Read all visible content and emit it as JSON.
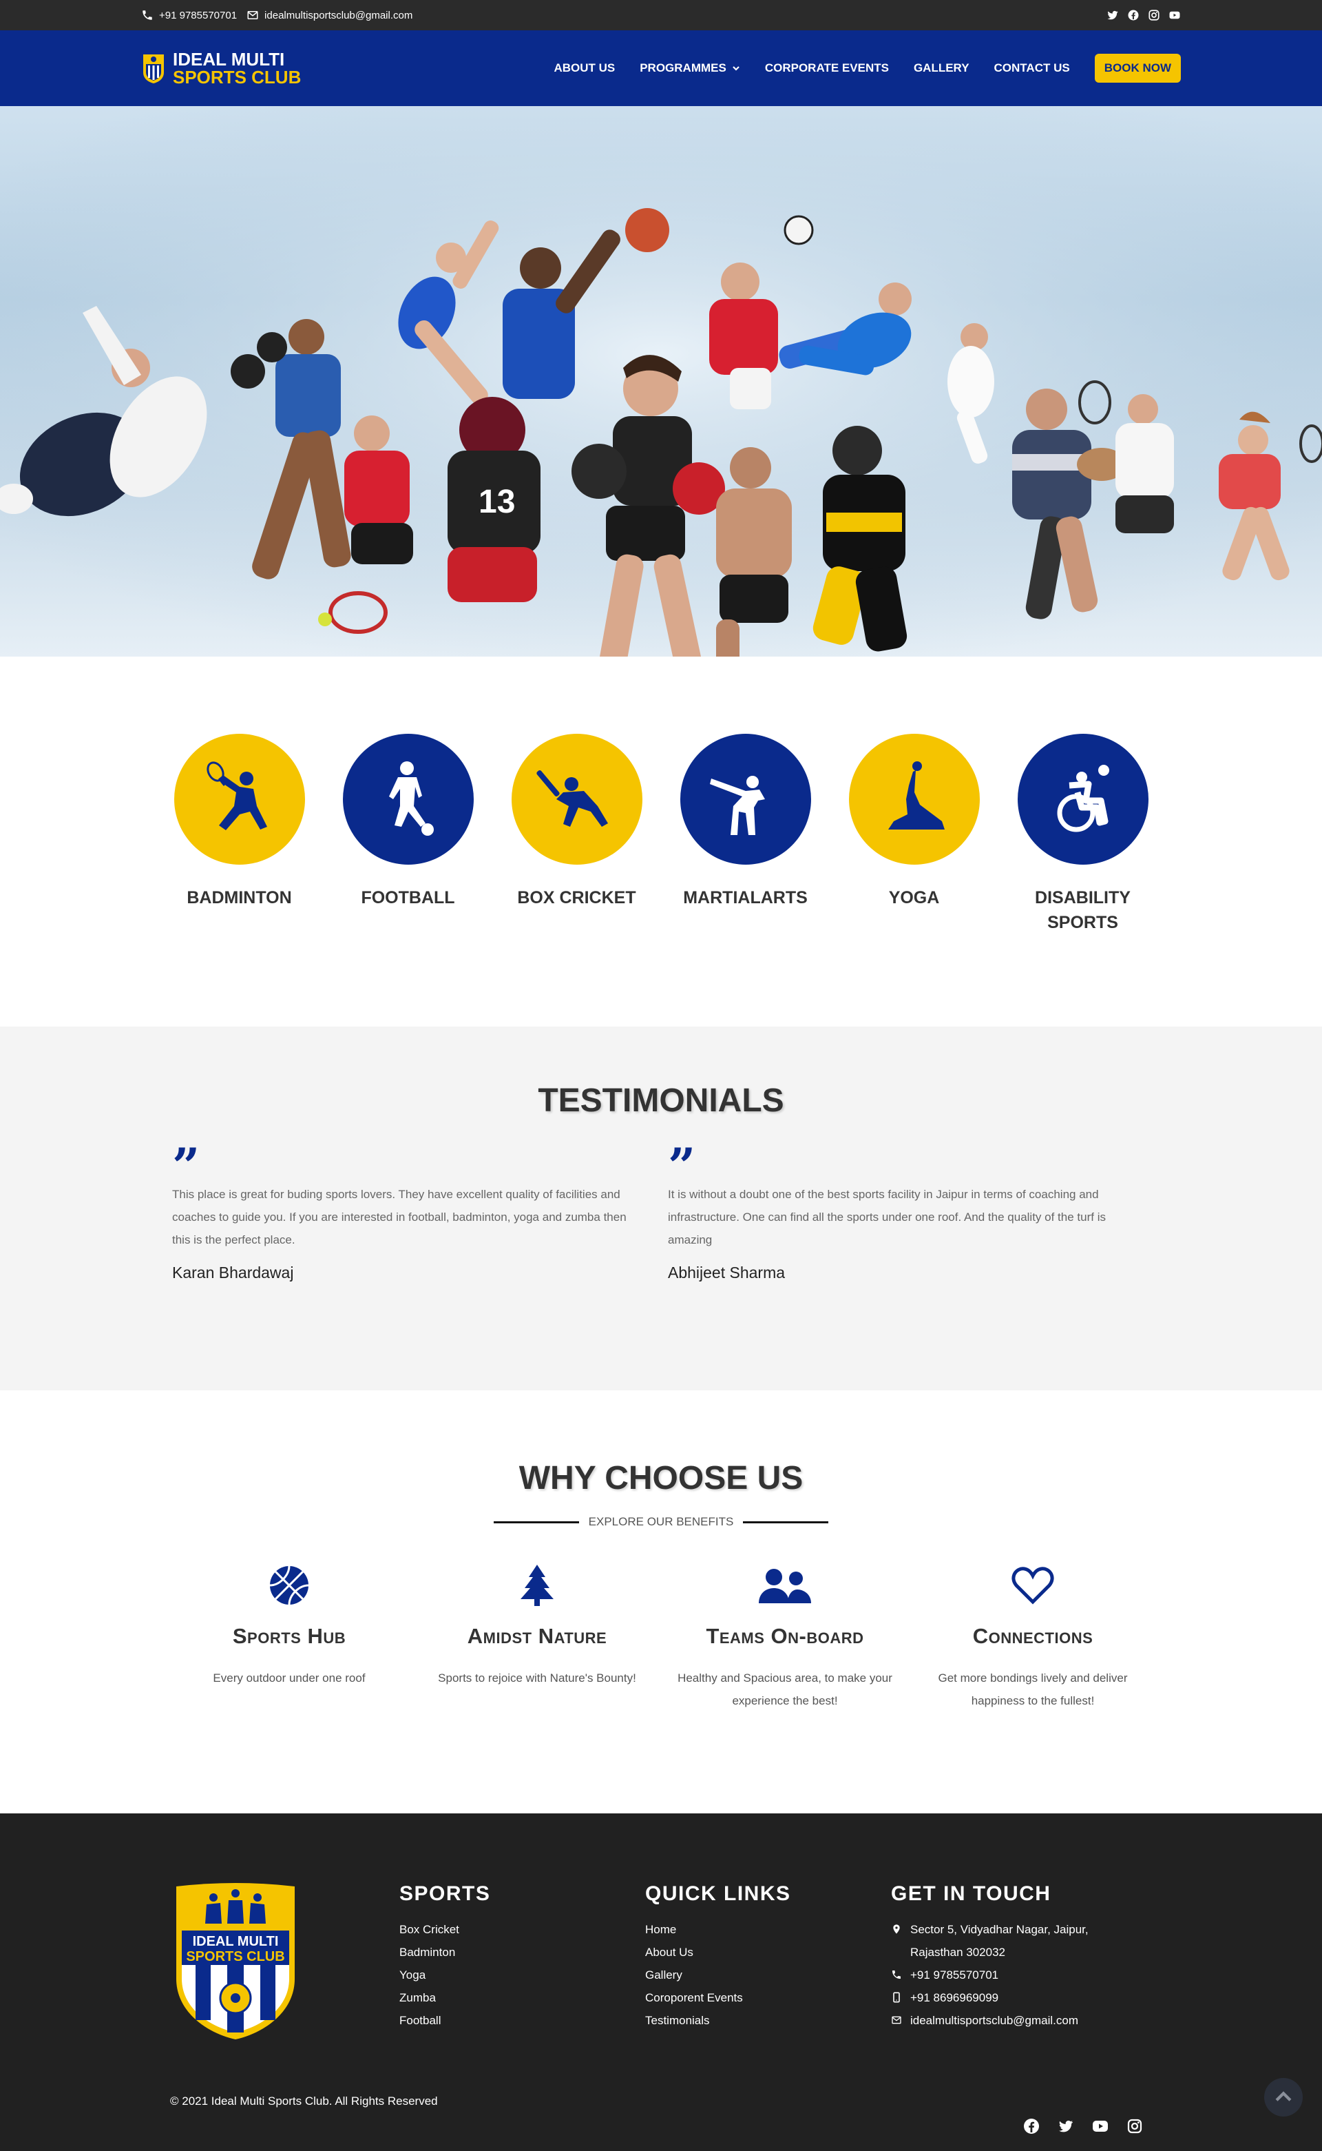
{
  "topbar": {
    "phone": "+91 9785570701",
    "email": "idealmultisportsclub@gmail.com",
    "social_icons": [
      "twitter-icon",
      "facebook-icon",
      "instagram-icon",
      "youtube-icon"
    ]
  },
  "header": {
    "logo_line1": "IDEAL MULTI",
    "logo_line2": "SPORTS CLUB",
    "nav": {
      "about": "ABOUT US",
      "programmes": "PROGRAMMES",
      "corporate": "CORPORATE EVENTS",
      "gallery": "GALLERY",
      "contact": "CONTACT US",
      "book": "BOOK NOW"
    }
  },
  "sports": [
    {
      "label": "BADMINTON",
      "color": "#f5c400"
    },
    {
      "label": "FOOTBALL",
      "color": "#0a2a8c"
    },
    {
      "label": "BOX CRICKET",
      "color": "#f5c400"
    },
    {
      "label": "MARTIALARTS",
      "color": "#0a2a8c"
    },
    {
      "label": "YOGA",
      "color": "#f5c400"
    },
    {
      "label": "DISABILITY SPORTS",
      "color": "#0a2a8c"
    }
  ],
  "testimonials": {
    "title": "TESTIMONIALS",
    "items": [
      {
        "text": "This place is great for buding sports lovers. They have excellent quality of facilities and coaches to guide you. If you are interested in football, badminton, yoga and zumba then this is the perfect place.",
        "author": "Karan Bhardawaj"
      },
      {
        "text": "It is without a doubt one of the best sports facility in Jaipur in terms of coaching and infrastructure. One can find all the sports under one roof. And the quality of the turf is amazing",
        "author": "Abhijeet Sharma"
      }
    ]
  },
  "why": {
    "title": "WHY CHOOSE US",
    "subtitle": "EXPLORE OUR BENEFITS",
    "features": [
      {
        "title": "Sports Hub",
        "text": "Every outdoor under one roof",
        "icon": "basketball-icon"
      },
      {
        "title": "Amidst Nature",
        "text": "Sports to rejoice with Nature's Bounty!",
        "icon": "tree-icon"
      },
      {
        "title": "Teams On-board",
        "text": "Healthy and Spacious area, to make your experience the best!",
        "icon": "users-icon"
      },
      {
        "title": "Connections",
        "text": "Get more bondings lively and deliver happiness to the fullest!",
        "icon": "heart-icon"
      }
    ]
  },
  "footer": {
    "crest_text1": "IDEAL MULTI",
    "crest_text2": "SPORTS CLUB",
    "sports_title": "SPORTS",
    "sports_links": [
      "Box Cricket",
      "Badminton",
      "Yoga",
      "Zumba",
      "Football"
    ],
    "quick_title": "QUICK LINKS",
    "quick_links": [
      "Home",
      "About Us",
      "Gallery",
      "Coroporent Events",
      "Testimonials"
    ],
    "touch_title": "GET IN TOUCH",
    "address_line1": "Sector 5, Vidyadhar Nagar, Jaipur,",
    "address_line2": "Rajasthan 302032",
    "phone": "+91 9785570701",
    "mobile": "+91 8696969099",
    "email": "idealmultisportsclub@gmail.com",
    "copyright": "© 2021 Ideal Multi Sports Club. All Rights Reserved"
  },
  "colors": {
    "navy": "#0a2a8c",
    "yellow": "#f5c400",
    "dark": "#212121"
  }
}
